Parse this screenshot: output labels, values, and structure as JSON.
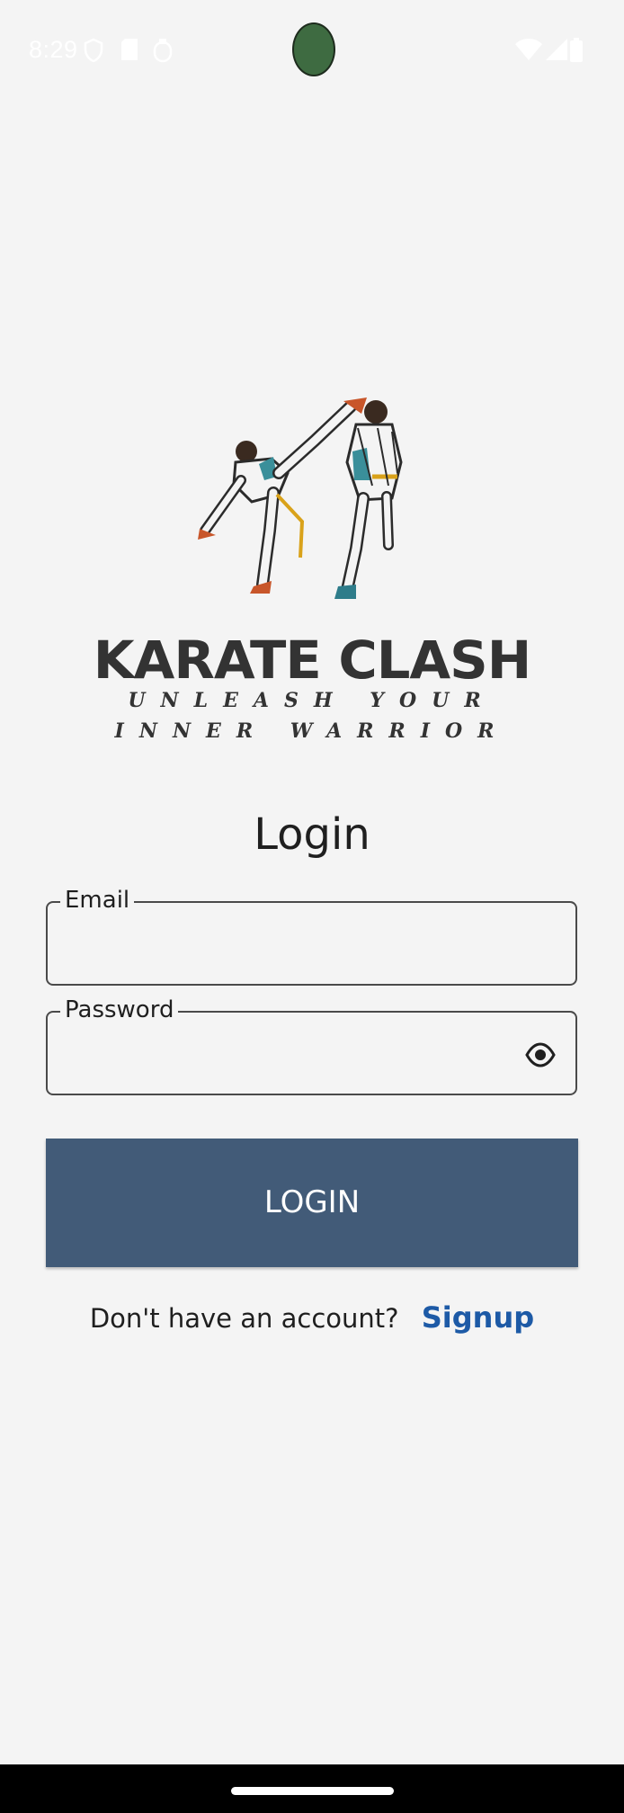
{
  "status_bar": {
    "time": "8:29",
    "left_icons": [
      "shield-icon",
      "sim-card-icon",
      "circle-badge-icon"
    ],
    "right_icons": [
      "wifi-icon",
      "signal-icon",
      "battery-icon"
    ]
  },
  "brand": {
    "title": "KARATE CLASH",
    "tagline_line1": "UNLEASH YOUR",
    "tagline_line2": "INNER WARRIOR",
    "logo_icon": "karate-fighters-illustration"
  },
  "login_form": {
    "heading": "Login",
    "email_label": "Email",
    "email_value": "",
    "password_label": "Password",
    "password_value": "",
    "password_toggle_icon": "eye-icon",
    "submit_label": "LOGIN"
  },
  "signup": {
    "question": "Don't have an account?",
    "link_label": "Signup"
  },
  "colors": {
    "background": "#f4f4f4",
    "button": "#425b78",
    "link": "#1d5aa6",
    "text": "#1f1f1f"
  }
}
